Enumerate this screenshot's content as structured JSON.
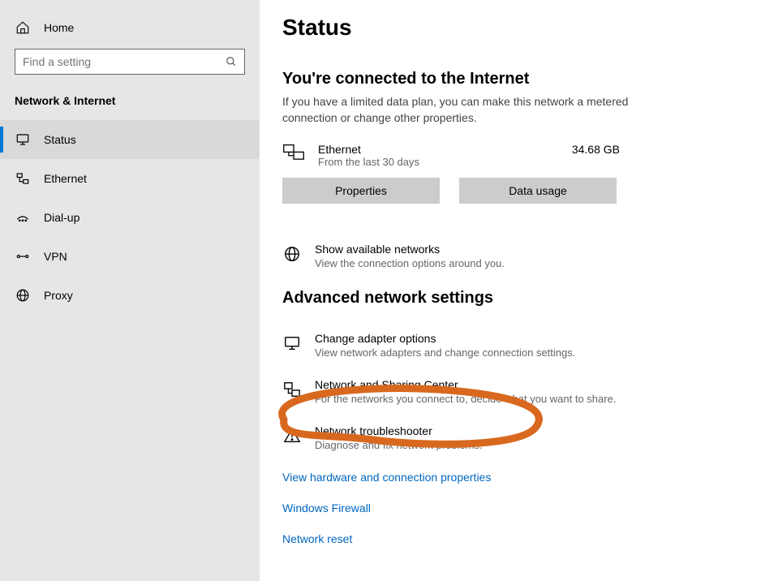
{
  "sidebar": {
    "home": "Home",
    "search_placeholder": "Find a setting",
    "category": "Network & Internet",
    "items": [
      {
        "label": "Status"
      },
      {
        "label": "Ethernet"
      },
      {
        "label": "Dial-up"
      },
      {
        "label": "VPN"
      },
      {
        "label": "Proxy"
      }
    ]
  },
  "main": {
    "title": "Status",
    "connected_heading": "You're connected to the Internet",
    "connected_desc": "If you have a limited data plan, you can make this network a metered connection or change other properties.",
    "connection": {
      "name": "Ethernet",
      "period": "From the last 30 days",
      "usage": "34.68 GB"
    },
    "buttons": {
      "properties": "Properties",
      "data_usage": "Data usage"
    },
    "show_networks": {
      "title": "Show available networks",
      "desc": "View the connection options around you."
    },
    "advanced_heading": "Advanced network settings",
    "adapter": {
      "title": "Change adapter options",
      "desc": "View network adapters and change connection settings."
    },
    "sharing": {
      "title": "Network and Sharing Center",
      "desc": "For the networks you connect to, decide what you want to share."
    },
    "troubleshoot": {
      "title": "Network troubleshooter",
      "desc": "Diagnose and fix network problems."
    },
    "links": {
      "hardware": "View hardware and connection properties",
      "firewall": "Windows Firewall",
      "reset": "Network reset"
    }
  }
}
